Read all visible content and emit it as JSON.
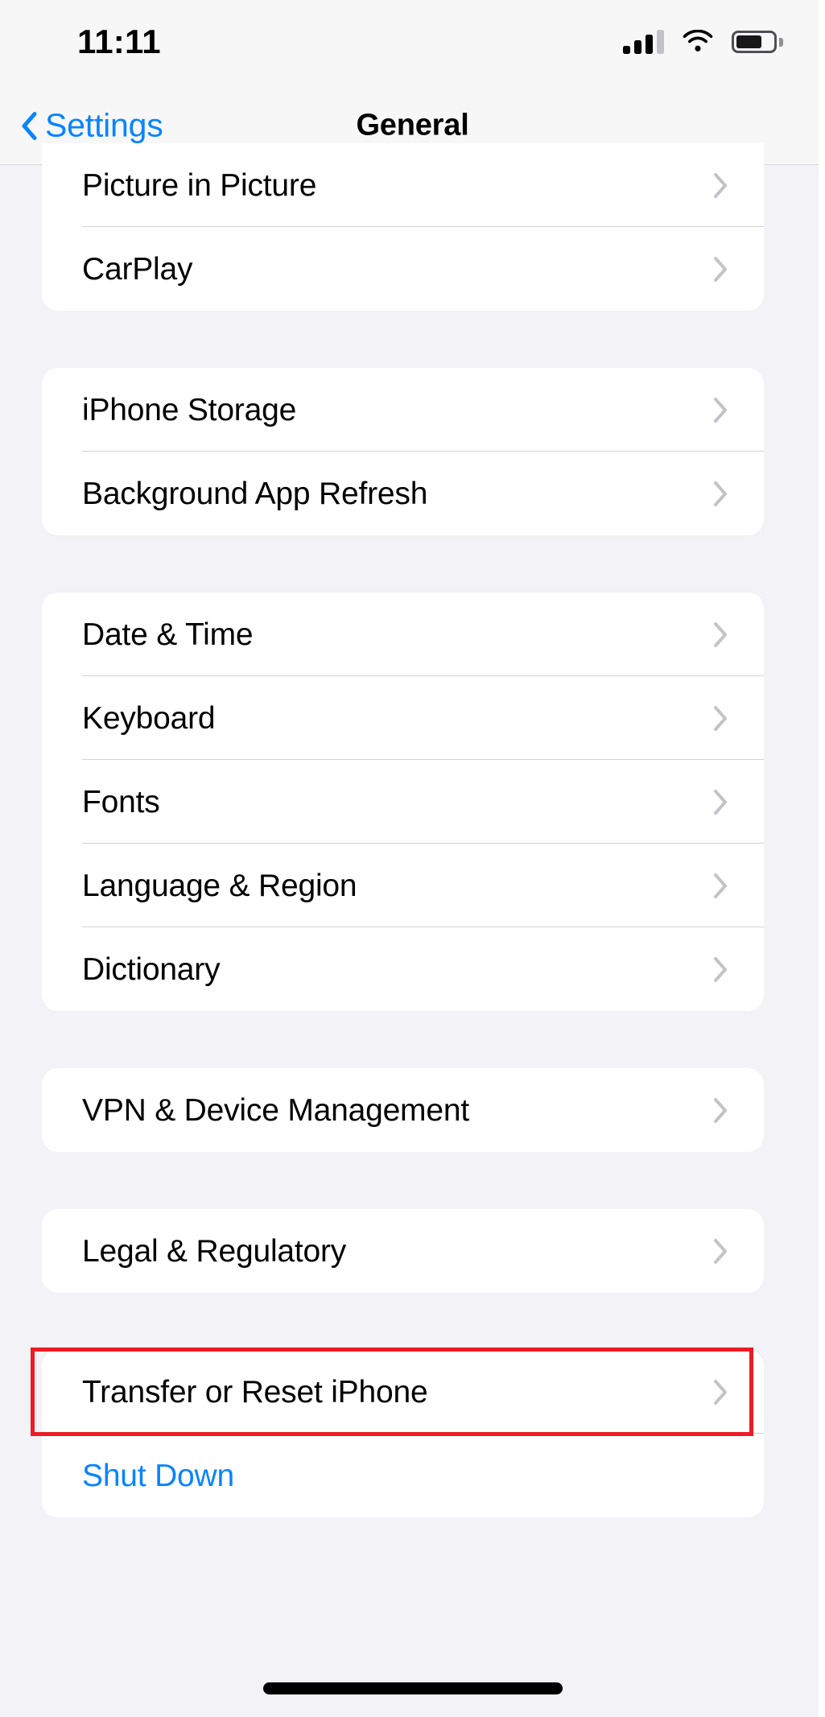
{
  "status_bar": {
    "time": "11:11",
    "cellular_icon": "cellular-signal-icon",
    "cellular_bars_total": 4,
    "cellular_bars_filled": 3,
    "wifi_icon": "wifi-icon",
    "wifi_strength": "full",
    "battery_icon": "battery-icon",
    "battery_percent": 62
  },
  "nav_bar": {
    "back_icon": "chevron-left-icon",
    "back_label": "Settings",
    "title": "General"
  },
  "colors": {
    "accent_blue": "#0a84ff",
    "page_background": "#f2f2f7",
    "card_background": "#ffffff",
    "separator": "#d2d2d6",
    "highlight_red": "#ec1c24",
    "chevron_gray": "#c4c4c8"
  },
  "groups": [
    {
      "id": "media-group",
      "rows": [
        {
          "label": "Picture in Picture",
          "accessory": "chevron-right-icon",
          "style": "default"
        },
        {
          "label": "CarPlay",
          "accessory": "chevron-right-icon",
          "style": "default"
        }
      ]
    },
    {
      "id": "storage-group",
      "rows": [
        {
          "label": "iPhone Storage",
          "accessory": "chevron-right-icon",
          "style": "default"
        },
        {
          "label": "Background App Refresh",
          "accessory": "chevron-right-icon",
          "style": "default"
        }
      ]
    },
    {
      "id": "localization-group",
      "rows": [
        {
          "label": "Date & Time",
          "accessory": "chevron-right-icon",
          "style": "default"
        },
        {
          "label": "Keyboard",
          "accessory": "chevron-right-icon",
          "style": "default"
        },
        {
          "label": "Fonts",
          "accessory": "chevron-right-icon",
          "style": "default"
        },
        {
          "label": "Language & Region",
          "accessory": "chevron-right-icon",
          "style": "default"
        },
        {
          "label": "Dictionary",
          "accessory": "chevron-right-icon",
          "style": "default"
        }
      ]
    },
    {
      "id": "vpn-group",
      "rows": [
        {
          "label": "VPN & Device Management",
          "accessory": "chevron-right-icon",
          "style": "default"
        }
      ]
    },
    {
      "id": "legal-group",
      "rows": [
        {
          "label": "Legal & Regulatory",
          "accessory": "chevron-right-icon",
          "style": "default"
        }
      ]
    },
    {
      "id": "reset-group",
      "rows": [
        {
          "label": "Transfer or Reset iPhone",
          "accessory": "chevron-right-icon",
          "style": "default",
          "highlighted": true
        },
        {
          "label": "Shut Down",
          "accessory": "none",
          "style": "link"
        }
      ]
    }
  ],
  "home_indicator": "home-indicator"
}
